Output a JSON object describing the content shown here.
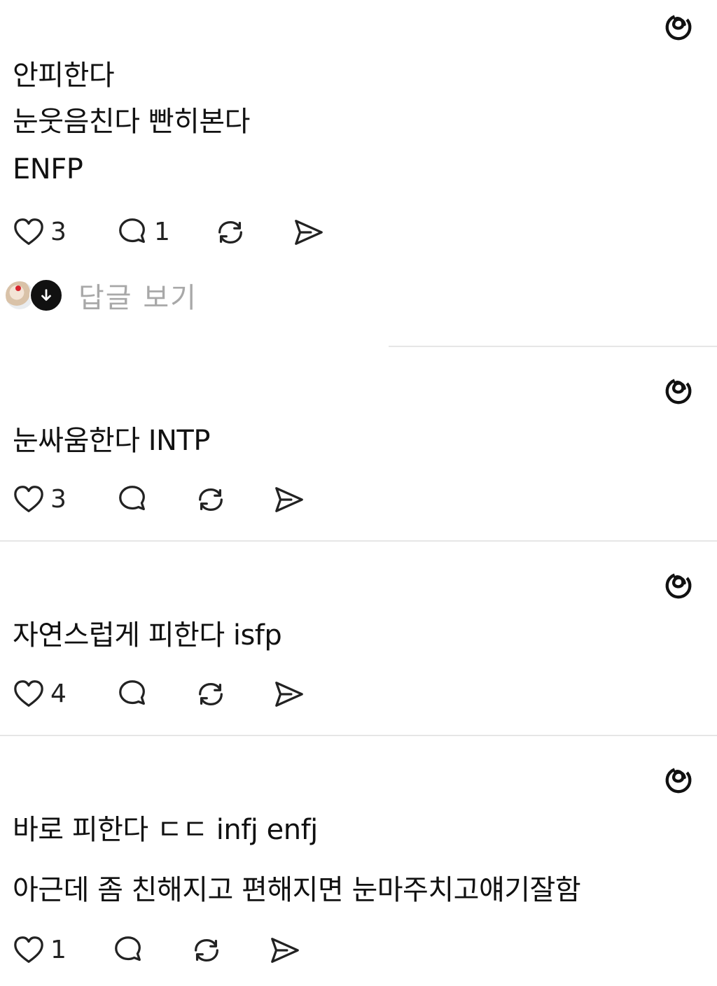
{
  "posts": [
    {
      "lines": [
        "안피한다",
        "눈웃음친다 빤히본다",
        "ENFP"
      ],
      "likes": "3",
      "comments": "1",
      "replies_label": "답글 보기"
    },
    {
      "lines": [
        "눈싸움한다 INTP"
      ],
      "likes": "3",
      "comments": ""
    },
    {
      "lines": [
        "자연스럽게 피한다 isfp"
      ],
      "likes": "4",
      "comments": ""
    },
    {
      "lines": [
        "바로 피한다 ㄷㄷ infj enfj",
        "아근데 좀 친해지고 편해지면 눈마주치고얘기잘함"
      ],
      "likes": "1",
      "comments": ""
    }
  ],
  "icons": {
    "brand": "threads-icon",
    "like": "heart-icon",
    "comment": "comment-icon",
    "repost": "repost-icon",
    "share": "send-icon",
    "expand": "arrow-down-icon"
  },
  "colors": {
    "text": "#111111",
    "muted": "#a8a8a8",
    "divider": "#e6e6e6"
  }
}
